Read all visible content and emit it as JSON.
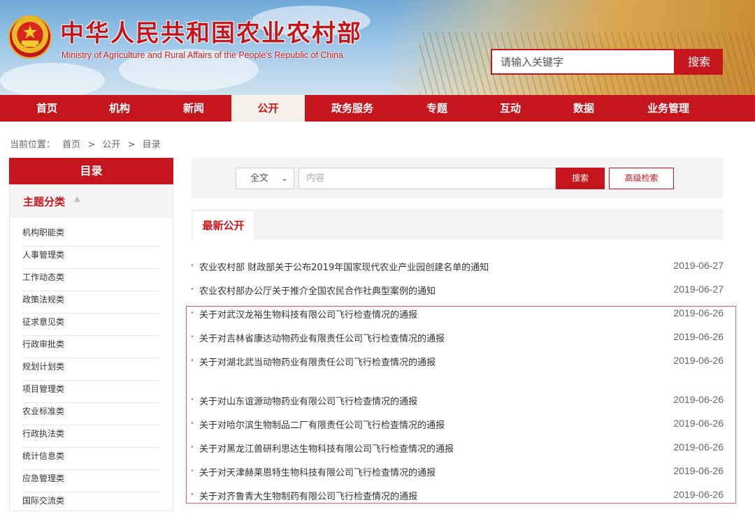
{
  "site": {
    "title": "中华人民共和国农业农村部",
    "subtitle": "Ministry of Agriculture and Rural Affairs of the People's Republic of China",
    "search_placeholder": "请输入关键字",
    "search_button": "搜索"
  },
  "nav": {
    "items": [
      "首页",
      "机构",
      "新闻",
      "公开",
      "政务服务",
      "专题",
      "互动",
      "数据",
      "业务管理"
    ],
    "active": "公开"
  },
  "breadcrumb": {
    "label": "当前位置：",
    "items": [
      "首页",
      ">",
      "公开",
      ">",
      "目录"
    ]
  },
  "sidebar": {
    "header": "目录",
    "topic": "主题分类",
    "topic_caret": "▲",
    "categories": [
      "机构职能类",
      "人事管理类",
      "工作动态类",
      "政策法规类",
      "征求意见类",
      "行政审批类",
      "规划计划类",
      "项目管理类",
      "农业标准类",
      "行政执法类",
      "统计信息类",
      "应急管理类",
      "国际交流类"
    ]
  },
  "filter": {
    "select_value": "全文",
    "input_placeholder": "内容",
    "search_button": "搜索",
    "advanced_button": "高级检索"
  },
  "latest": {
    "tab_label": "最新公开",
    "items": [
      {
        "title": "农业农村部 财政部关于公布2019年国家现代农业产业园创建名单的通知",
        "date": "2019-06-27"
      },
      {
        "title": "农业农村部办公厅关于推介全国农民合作社典型案例的通知",
        "date": "2019-06-27"
      },
      {
        "title": "关于对武汉龙裕生物科技有限公司飞行检查情况的通报",
        "date": "2019-06-26"
      },
      {
        "title": "关于对吉林省康达动物药业有限责任公司飞行检查情况的通报",
        "date": "2019-06-26"
      },
      {
        "title": "关于对湖北武当动物药业有限责任公司飞行检查情况的通报",
        "date": "2019-06-26"
      },
      {
        "title": "关于对山东谊源动物药业有限公司飞行检查情况的通报",
        "date": "2019-06-26"
      },
      {
        "title": "关于对哈尔滨生物制品二厂有限责任公司飞行检查情况的通报",
        "date": "2019-06-26"
      },
      {
        "title": "关于对黑龙江兽研利思达生物科技有限公司飞行检查情况的通报",
        "date": "2019-06-26"
      },
      {
        "title": "关于对天津赫莱恩特生物科技有限公司飞行检查情况的通报",
        "date": "2019-06-26"
      },
      {
        "title": "关于对齐鲁青大生物制药有限公司飞行检查情况的通报",
        "date": "2019-06-26"
      }
    ]
  },
  "colors": {
    "brand_red": "#c4161c",
    "highlight_border": "#e06060"
  }
}
